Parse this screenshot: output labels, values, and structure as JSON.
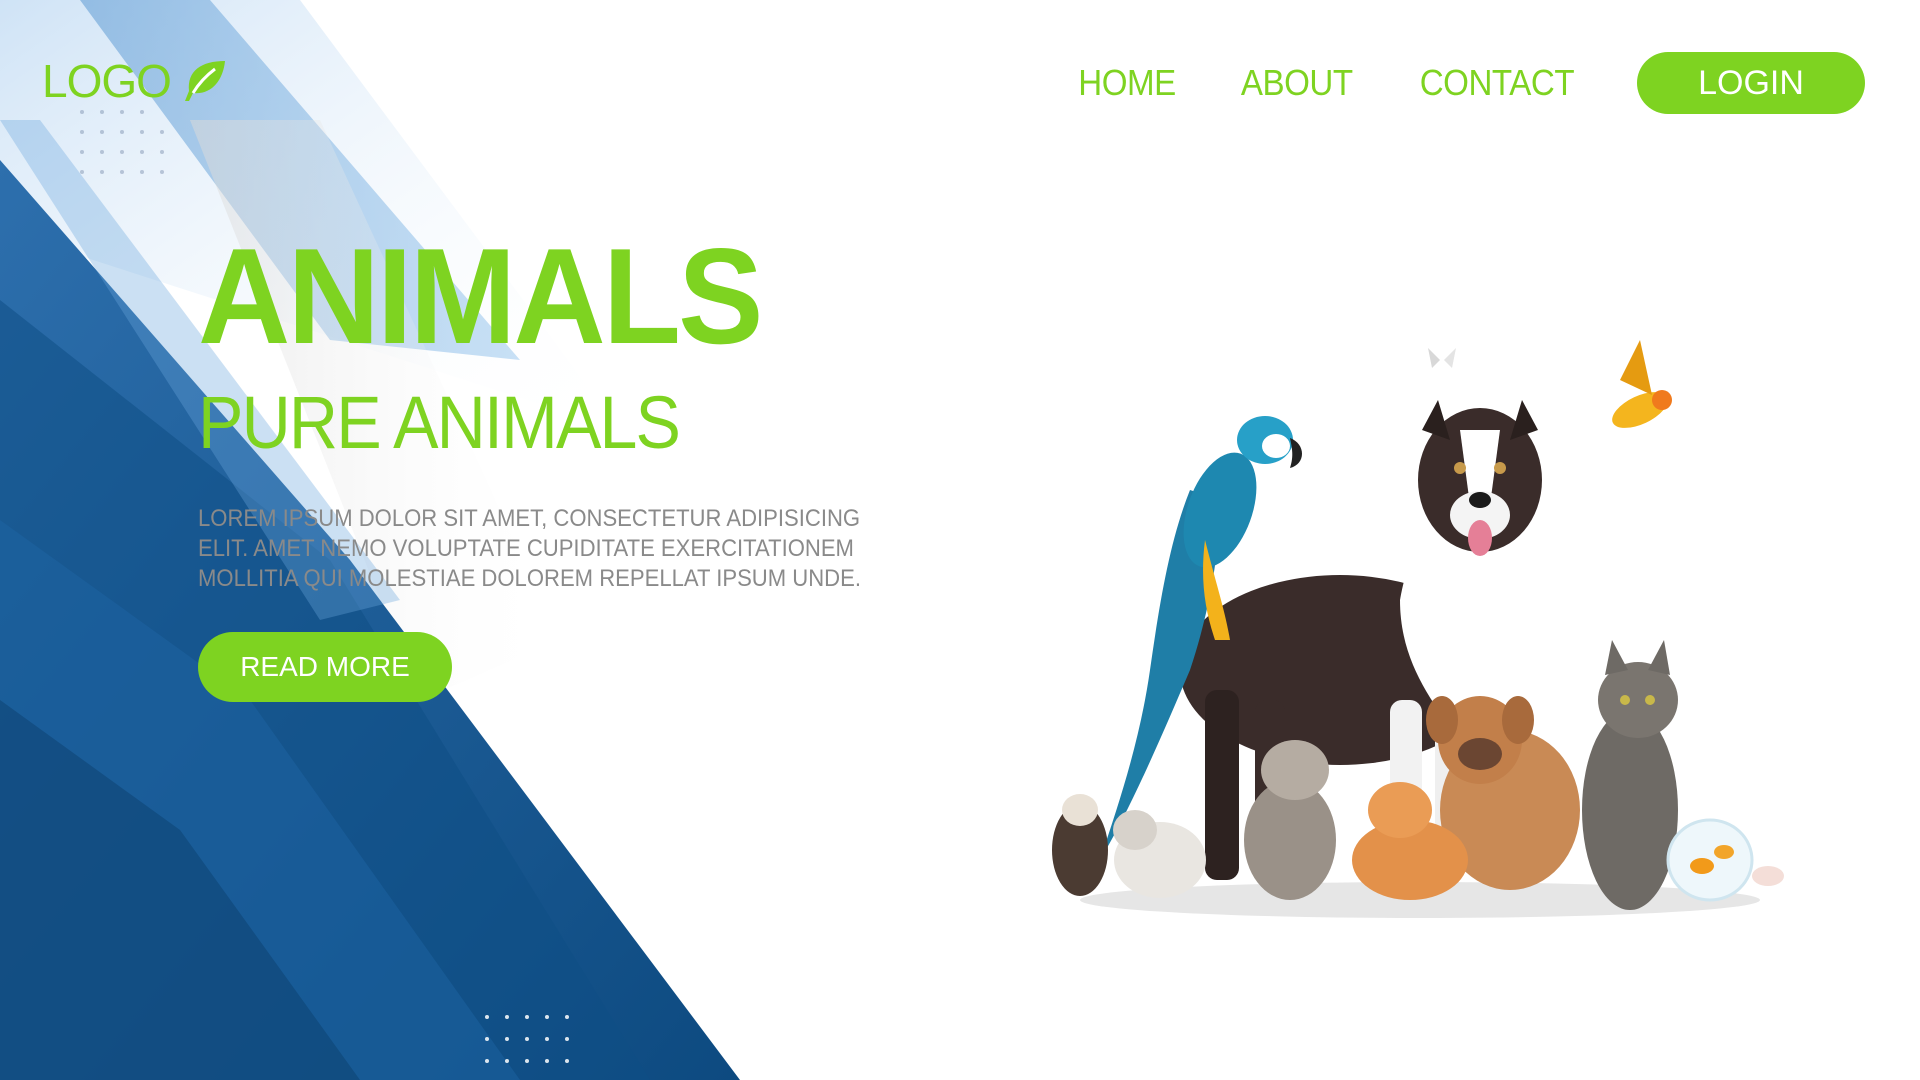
{
  "brand": {
    "logo_text": "LOGO",
    "accent": "#7ed321",
    "icon": "leaf-icon"
  },
  "nav": {
    "items": [
      {
        "label": "HOME"
      },
      {
        "label": "ABOUT"
      },
      {
        "label": "CONTACT"
      }
    ],
    "login_label": "LOGIN"
  },
  "hero": {
    "title": "ANIMALS",
    "subtitle": "PURE ANIMALS",
    "description": "LOREM IPSUM DOLOR SIT AMET, CONSECTETUR ADIPISICING ELIT. AMET NEMO VOLUPTATE CUPIDITATE EXERCITATIONEM MOLLITIA QUI MOLESTIAE DOLOREM REPELLAT IPSUM UNDE.",
    "button_label": "READ MORE"
  },
  "colors": {
    "dark_blue": "#0f4f85",
    "mid_blue": "#2a6fae",
    "light_blue": "#8ec0ea",
    "text_gray": "#8a8a8a"
  },
  "illustration": "animals-group-image"
}
